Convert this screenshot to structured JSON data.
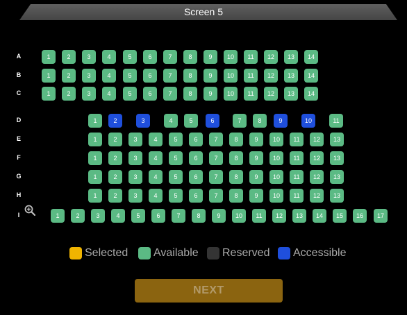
{
  "screen": {
    "label": "Screen 5"
  },
  "colors": {
    "available": "#5bba84",
    "accessible": "#1f4fdc",
    "selected": "#f0b400",
    "reserved": "#343434",
    "next_button": "#8b6410"
  },
  "rows": [
    {
      "label": "A",
      "seats": [
        {
          "n": "1",
          "s": "available"
        },
        {
          "n": "2",
          "s": "available"
        },
        {
          "n": "3",
          "s": "available"
        },
        {
          "n": "4",
          "s": "available"
        },
        {
          "n": "5",
          "s": "available"
        },
        {
          "n": "6",
          "s": "available"
        },
        {
          "n": "7",
          "s": "available"
        },
        {
          "n": "8",
          "s": "available"
        },
        {
          "n": "9",
          "s": "available"
        },
        {
          "n": "10",
          "s": "available"
        },
        {
          "n": "11",
          "s": "available"
        },
        {
          "n": "12",
          "s": "available"
        },
        {
          "n": "13",
          "s": "available"
        },
        {
          "n": "14",
          "s": "available"
        }
      ]
    },
    {
      "label": "B",
      "seats": [
        {
          "n": "1",
          "s": "available"
        },
        {
          "n": "2",
          "s": "available"
        },
        {
          "n": "3",
          "s": "available"
        },
        {
          "n": "4",
          "s": "available"
        },
        {
          "n": "5",
          "s": "available"
        },
        {
          "n": "6",
          "s": "available"
        },
        {
          "n": "7",
          "s": "available"
        },
        {
          "n": "8",
          "s": "available"
        },
        {
          "n": "9",
          "s": "available"
        },
        {
          "n": "10",
          "s": "available"
        },
        {
          "n": "11",
          "s": "available"
        },
        {
          "n": "12",
          "s": "available"
        },
        {
          "n": "13",
          "s": "available"
        },
        {
          "n": "14",
          "s": "available"
        }
      ]
    },
    {
      "label": "C",
      "seats": [
        {
          "n": "1",
          "s": "available"
        },
        {
          "n": "2",
          "s": "available"
        },
        {
          "n": "3",
          "s": "available"
        },
        {
          "n": "4",
          "s": "available"
        },
        {
          "n": "5",
          "s": "available"
        },
        {
          "n": "6",
          "s": "available"
        },
        {
          "n": "7",
          "s": "available"
        },
        {
          "n": "8",
          "s": "available"
        },
        {
          "n": "9",
          "s": "available"
        },
        {
          "n": "10",
          "s": "available"
        },
        {
          "n": "11",
          "s": "available"
        },
        {
          "n": "12",
          "s": "available"
        },
        {
          "n": "13",
          "s": "available"
        },
        {
          "n": "14",
          "s": "available"
        }
      ]
    },
    {
      "label": "D",
      "seats": [
        {
          "n": "1",
          "s": "available"
        },
        {
          "n": "2",
          "s": "accessible"
        },
        {
          "n": "3",
          "s": "accessible"
        },
        {
          "n": "4",
          "s": "available"
        },
        {
          "n": "5",
          "s": "available"
        },
        {
          "n": "6",
          "s": "accessible"
        },
        {
          "n": "7",
          "s": "available"
        },
        {
          "n": "8",
          "s": "available"
        },
        {
          "n": "9",
          "s": "accessible"
        },
        {
          "n": "10",
          "s": "accessible"
        },
        {
          "n": "11",
          "s": "available"
        }
      ]
    },
    {
      "label": "E",
      "seats": [
        {
          "n": "1",
          "s": "available"
        },
        {
          "n": "2",
          "s": "available"
        },
        {
          "n": "3",
          "s": "available"
        },
        {
          "n": "4",
          "s": "available"
        },
        {
          "n": "5",
          "s": "available"
        },
        {
          "n": "6",
          "s": "available"
        },
        {
          "n": "7",
          "s": "available"
        },
        {
          "n": "8",
          "s": "available"
        },
        {
          "n": "9",
          "s": "available"
        },
        {
          "n": "10",
          "s": "available"
        },
        {
          "n": "11",
          "s": "available"
        },
        {
          "n": "12",
          "s": "available"
        },
        {
          "n": "13",
          "s": "available"
        }
      ]
    },
    {
      "label": "F",
      "seats": [
        {
          "n": "1",
          "s": "available"
        },
        {
          "n": "2",
          "s": "available"
        },
        {
          "n": "3",
          "s": "available"
        },
        {
          "n": "4",
          "s": "available"
        },
        {
          "n": "5",
          "s": "available"
        },
        {
          "n": "6",
          "s": "available"
        },
        {
          "n": "7",
          "s": "available"
        },
        {
          "n": "8",
          "s": "available"
        },
        {
          "n": "9",
          "s": "available"
        },
        {
          "n": "10",
          "s": "available"
        },
        {
          "n": "11",
          "s": "available"
        },
        {
          "n": "12",
          "s": "available"
        },
        {
          "n": "13",
          "s": "available"
        }
      ]
    },
    {
      "label": "G",
      "seats": [
        {
          "n": "1",
          "s": "available"
        },
        {
          "n": "2",
          "s": "available"
        },
        {
          "n": "3",
          "s": "available"
        },
        {
          "n": "4",
          "s": "available"
        },
        {
          "n": "5",
          "s": "available"
        },
        {
          "n": "6",
          "s": "available"
        },
        {
          "n": "7",
          "s": "available"
        },
        {
          "n": "8",
          "s": "available"
        },
        {
          "n": "9",
          "s": "available"
        },
        {
          "n": "10",
          "s": "available"
        },
        {
          "n": "11",
          "s": "available"
        },
        {
          "n": "12",
          "s": "available"
        },
        {
          "n": "13",
          "s": "available"
        }
      ]
    },
    {
      "label": "H",
      "seats": [
        {
          "n": "1",
          "s": "available"
        },
        {
          "n": "2",
          "s": "available"
        },
        {
          "n": "3",
          "s": "available"
        },
        {
          "n": "4",
          "s": "available"
        },
        {
          "n": "5",
          "s": "available"
        },
        {
          "n": "6",
          "s": "available"
        },
        {
          "n": "7",
          "s": "available"
        },
        {
          "n": "8",
          "s": "available"
        },
        {
          "n": "9",
          "s": "available"
        },
        {
          "n": "10",
          "s": "available"
        },
        {
          "n": "11",
          "s": "available"
        },
        {
          "n": "12",
          "s": "available"
        },
        {
          "n": "13",
          "s": "available"
        }
      ]
    },
    {
      "label": "I",
      "seats": [
        {
          "n": "1",
          "s": "available"
        },
        {
          "n": "2",
          "s": "available"
        },
        {
          "n": "3",
          "s": "available"
        },
        {
          "n": "4",
          "s": "available"
        },
        {
          "n": "5",
          "s": "available"
        },
        {
          "n": "6",
          "s": "available"
        },
        {
          "n": "7",
          "s": "available"
        },
        {
          "n": "8",
          "s": "available"
        },
        {
          "n": "9",
          "s": "available"
        },
        {
          "n": "10",
          "s": "available"
        },
        {
          "n": "11",
          "s": "available"
        },
        {
          "n": "12",
          "s": "available"
        },
        {
          "n": "13",
          "s": "available"
        },
        {
          "n": "14",
          "s": "available"
        },
        {
          "n": "15",
          "s": "available"
        },
        {
          "n": "16",
          "s": "available"
        },
        {
          "n": "17",
          "s": "available"
        }
      ]
    }
  ],
  "zoom": {
    "icon": "zoom-in-icon"
  },
  "legend": {
    "selected": "Selected",
    "available": "Available",
    "reserved": "Reserved",
    "accessible": "Accessible"
  },
  "next_button": {
    "label": "NEXT"
  }
}
